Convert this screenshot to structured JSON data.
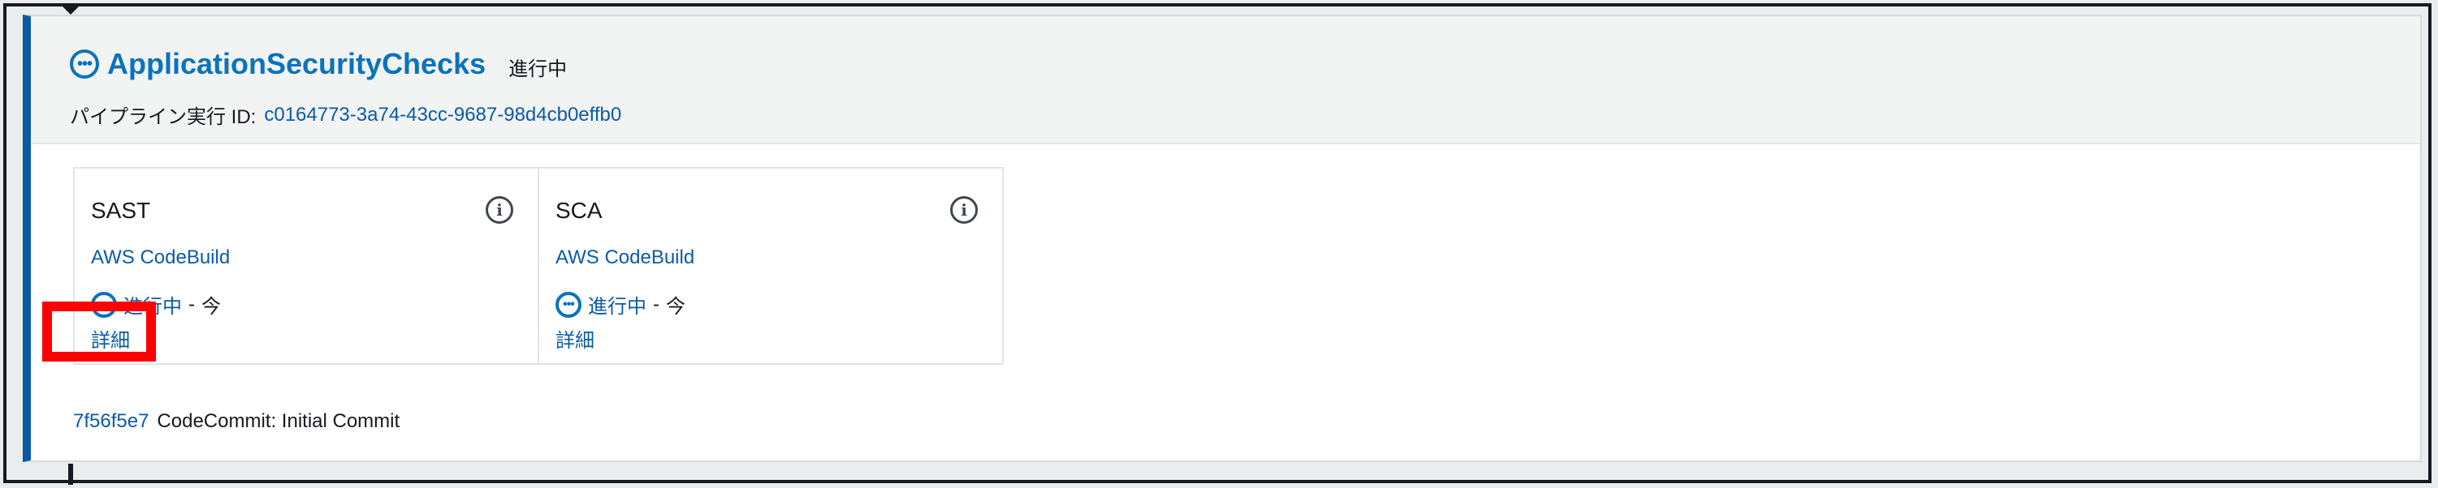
{
  "stage": {
    "name": "ApplicationSecurityChecks",
    "status": "進行中",
    "execution_label": "パイプライン実行 ID:",
    "execution_id": "c0164773-3a74-43cc-9687-98d4cb0effb0",
    "status_icon_glyph": "•••"
  },
  "actions": [
    {
      "name": "SAST",
      "provider": "AWS CodeBuild",
      "status": "進行中",
      "separator": "-",
      "time": "今",
      "details_label": "詳細",
      "status_icon_glyph": "•••",
      "info_icon_glyph": "i"
    },
    {
      "name": "SCA",
      "provider": "AWS CodeBuild",
      "status": "進行中",
      "separator": "-",
      "time": "今",
      "details_label": "詳細",
      "status_icon_glyph": "•••",
      "info_icon_glyph": "i"
    }
  ],
  "commit": {
    "id": "7f56f5e7",
    "message": "CodeCommit: Initial Commit"
  },
  "colors": {
    "accent": "#0b73bb",
    "link": "#0b5aa8",
    "stage_border": "#0b5aa8",
    "highlight": "#ff0000"
  }
}
